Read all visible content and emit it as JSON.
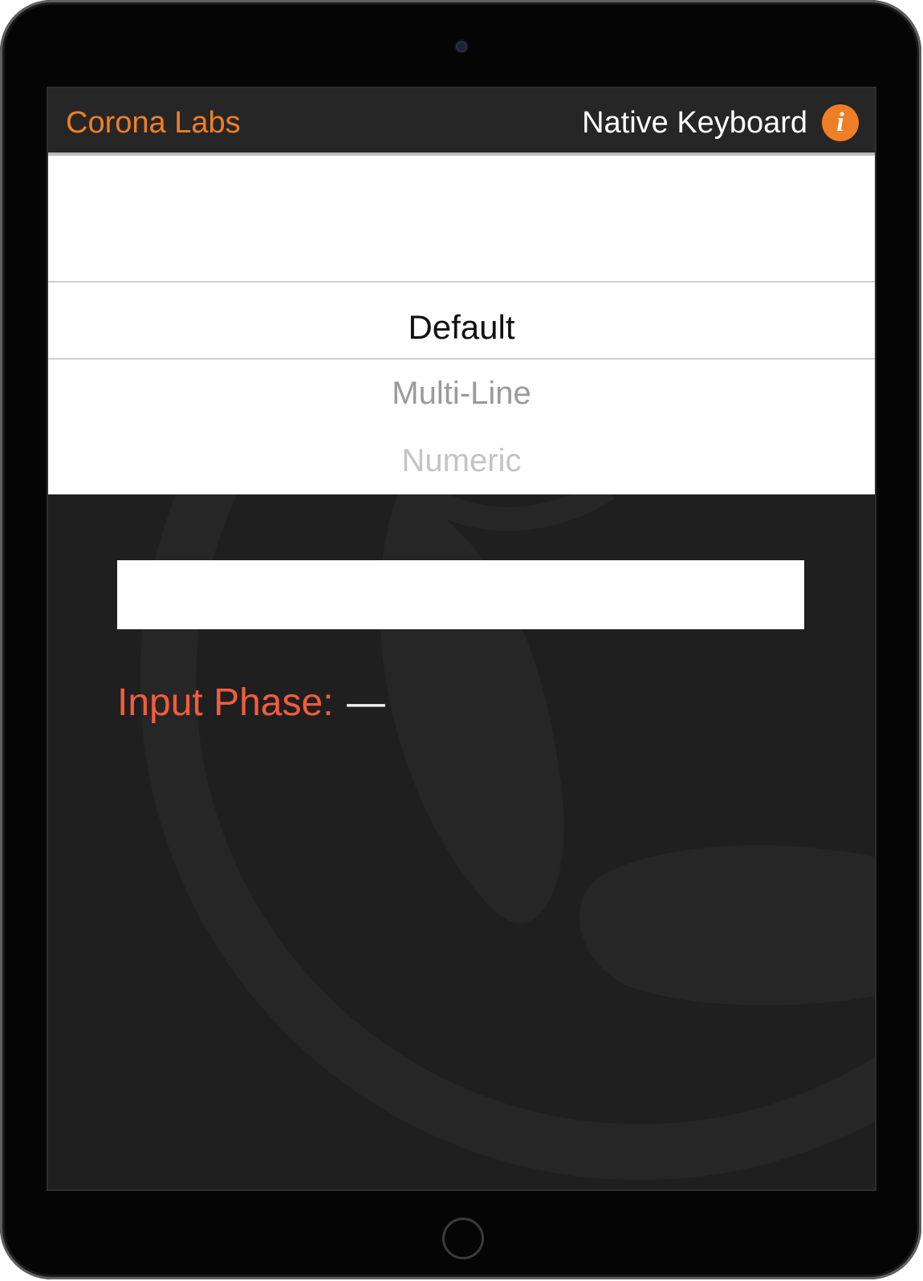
{
  "navbar": {
    "left_label": "Corona Labs",
    "title": "Native Keyboard",
    "info_icon": "i"
  },
  "picker": {
    "options": [
      "Default",
      "Multi-Line",
      "Numeric"
    ],
    "selected": "Default"
  },
  "input": {
    "value": ""
  },
  "phase": {
    "label": "Input Phase:",
    "value": "—"
  },
  "colors": {
    "accent": "#f07e26",
    "phase_label": "#f25c3c",
    "navbar": "#262626",
    "screen_bg": "#1f1f20"
  }
}
